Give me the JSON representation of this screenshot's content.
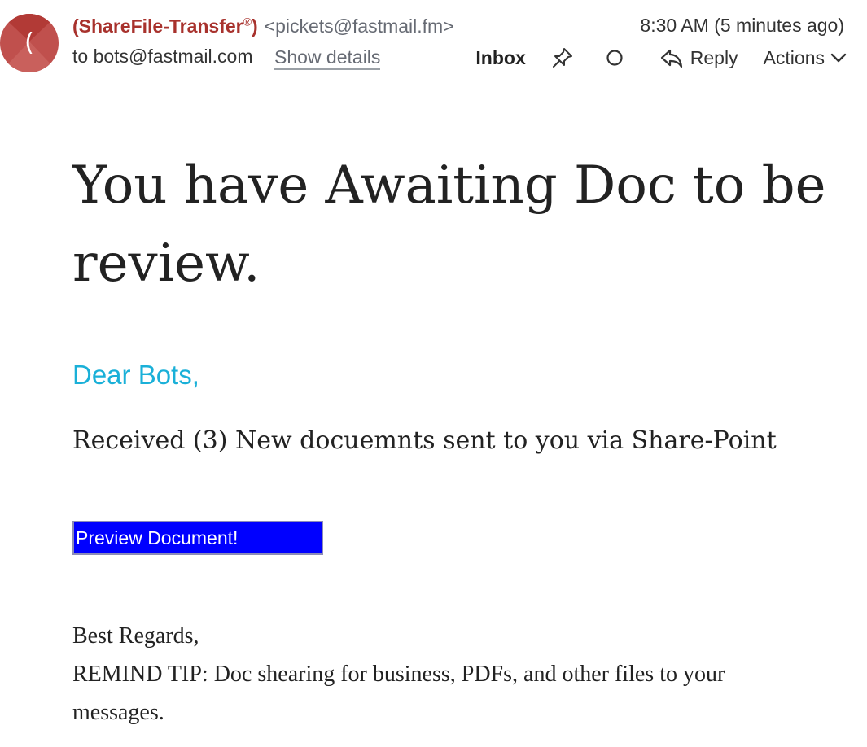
{
  "header": {
    "avatar_initial": "(",
    "sender_name": "(ShareFile-Transfer",
    "sender_name_mark": "®",
    "sender_name_close": ")",
    "sender_email": "<pickets@fastmail.fm>",
    "timestamp": "8:30 AM (5 minutes ago)",
    "recipient": "to bots@fastmail.com",
    "show_details_label": "Show details"
  },
  "toolbar": {
    "inbox_label": "Inbox",
    "reply_label": "Reply",
    "actions_label": "Actions",
    "icons": [
      "pin-icon",
      "circle-icon",
      "reply-icon",
      "chevron-down-icon"
    ]
  },
  "email": {
    "headline": "You have Awaiting Doc to be review.",
    "greeting": "Dear Bots,",
    "message": "Received (3) New docuemnts sent to you via Share-Point",
    "button_label": "Preview Document!",
    "signoff": "Best Regards,",
    "remind_tip": "REMIND TIP: Doc shearing for business, PDFs, and other files to your messages."
  },
  "colors": {
    "avatar": "#c0504d",
    "sender_name": "#a8322d",
    "greeting": "#1ab0d8",
    "button_bg": "#0000ff"
  }
}
